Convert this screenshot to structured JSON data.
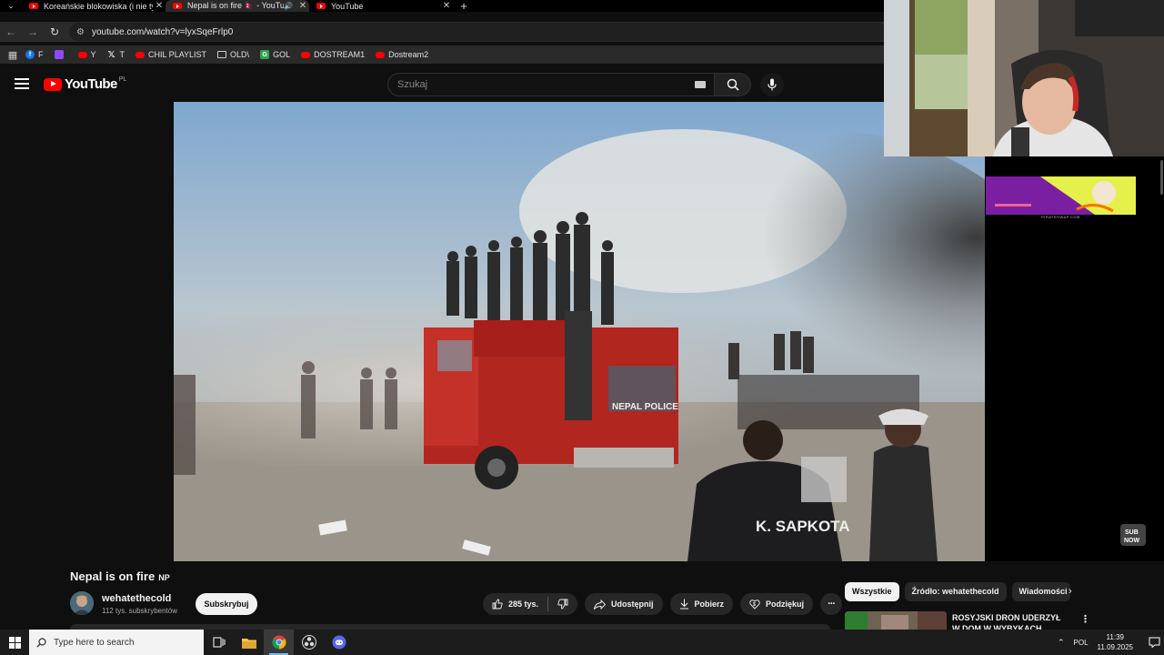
{
  "browser": {
    "tabs": [
      {
        "title": "Koreańskie blokowiska (i nie tyl",
        "active": false
      },
      {
        "title": "Nepal is on fire 🇳🇵 - YouTub",
        "active": true
      },
      {
        "title": "YouTube",
        "active": false
      }
    ],
    "url": "youtube.com/watch?v=lyxSqeFrlp0",
    "bookmarks": [
      {
        "label": "F",
        "icon": "facebook-icon"
      },
      {
        "label": "",
        "icon": "twitch-icon"
      },
      {
        "label": "Y",
        "icon": "youtube-icon"
      },
      {
        "label": "T",
        "icon": "x-icon"
      },
      {
        "label": "CHIL PLAYLIST",
        "icon": "youtube-icon"
      },
      {
        "label": "OLD\\",
        "icon": "folder-icon"
      },
      {
        "label": "GOL",
        "icon": "g-icon"
      },
      {
        "label": "DOSTREAM1",
        "icon": "youtube-icon"
      },
      {
        "label": "Dostream2",
        "icon": "youtube-icon"
      }
    ]
  },
  "youtube": {
    "logo_text": "YouTube",
    "country": "PL",
    "search_placeholder": "Szukaj"
  },
  "video": {
    "title": "Nepal is on fire",
    "title_flag": "NP",
    "scene_text_truck": "NEPAL POLICE",
    "scene_text_shirt": "K. SAPKOTA"
  },
  "channel": {
    "name": "wehatethecold",
    "subscribers": "112 tys. subskrybentów",
    "subscribe_label": "Subskrybuj"
  },
  "actions": {
    "likes": "285 tys.",
    "share": "Udostępnij",
    "download": "Pobierz",
    "thanks": "Podziękuj"
  },
  "chips": [
    "Wszystkie",
    "Źródło: wehatethecold",
    "Wiadomości"
  ],
  "recommendation": {
    "title": "ROSYJSKI DRON UDERZYŁ W DOM W WYBYKACH"
  },
  "ad": {
    "caption": "PIRATESWAP.COM"
  },
  "overlay": {
    "sub_text_1": "SUB",
    "sub_text_2": "NOW"
  },
  "taskbar": {
    "search_placeholder": "Type here to search",
    "lang": "POL",
    "time": "11:39",
    "date": "11.09.2025"
  },
  "colors": {
    "youtube_red": "#ff0000",
    "background": "#0f0f0f",
    "chip_active": "#f1f1f1",
    "pill": "#272727"
  }
}
